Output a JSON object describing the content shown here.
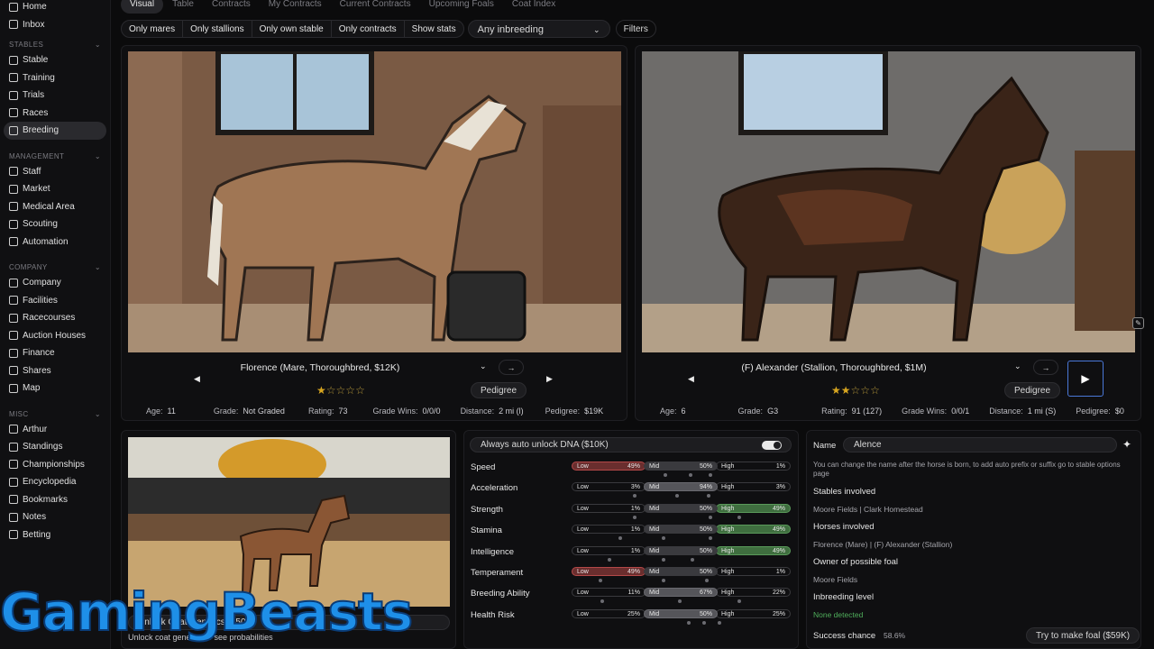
{
  "sidebar": {
    "top_items": [
      {
        "label": "Home",
        "icon": "home-icon"
      },
      {
        "label": "Inbox",
        "icon": "inbox-icon"
      }
    ],
    "groups": [
      {
        "title": "STABLES",
        "items": [
          {
            "label": "Stable",
            "icon": "stable-icon"
          },
          {
            "label": "Training",
            "icon": "training-icon"
          },
          {
            "label": "Trials",
            "icon": "trials-icon"
          },
          {
            "label": "Races",
            "icon": "races-icon"
          },
          {
            "label": "Breeding",
            "icon": "heart-icon",
            "active": true
          }
        ]
      },
      {
        "title": "MANAGEMENT",
        "items": [
          {
            "label": "Staff",
            "icon": "staff-icon"
          },
          {
            "label": "Market",
            "icon": "market-icon"
          },
          {
            "label": "Medical Area",
            "icon": "medical-icon"
          },
          {
            "label": "Scouting",
            "icon": "scouting-icon"
          },
          {
            "label": "Automation",
            "icon": "automation-icon"
          }
        ]
      },
      {
        "title": "COMPANY",
        "items": [
          {
            "label": "Company",
            "icon": "company-icon"
          },
          {
            "label": "Facilities",
            "icon": "facilities-icon"
          },
          {
            "label": "Racecourses",
            "icon": "racecourses-icon"
          },
          {
            "label": "Auction Houses",
            "icon": "auction-icon"
          },
          {
            "label": "Finance",
            "icon": "finance-icon"
          },
          {
            "label": "Shares",
            "icon": "shares-icon"
          },
          {
            "label": "Map",
            "icon": "map-icon"
          }
        ]
      },
      {
        "title": "MISC",
        "items": [
          {
            "label": "Arthur",
            "icon": "user-icon"
          },
          {
            "label": "Standings",
            "icon": "standings-icon"
          },
          {
            "label": "Championships",
            "icon": "championships-icon"
          },
          {
            "label": "Encyclopedia",
            "icon": "encyclopedia-icon"
          },
          {
            "label": "Bookmarks",
            "icon": "bookmark-icon"
          },
          {
            "label": "Notes",
            "icon": "notes-icon"
          },
          {
            "label": "Betting",
            "icon": "betting-icon"
          }
        ]
      }
    ]
  },
  "tabs": [
    "Visual",
    "Table",
    "Contracts",
    "My Contracts",
    "Current Contracts",
    "Upcoming Foals",
    "Coat Index"
  ],
  "filters": {
    "chips": [
      "Only mares",
      "Only stallions",
      "Only own stable",
      "Only contracts",
      "Show stats"
    ],
    "inbreeding_select": "Any inbreeding",
    "filters_button": "Filters"
  },
  "mare": {
    "title": "Florence (Mare, Thoroughbred, $12K)",
    "stars_filled": 1,
    "stars_total": 5,
    "pedigree_button": "Pedigree",
    "stats": [
      {
        "label": "Age:",
        "value": "11"
      },
      {
        "label": "Grade:",
        "value": "Not Graded"
      },
      {
        "label": "Rating:",
        "value": "73"
      },
      {
        "label": "Grade Wins:",
        "value": "0/0/0"
      },
      {
        "label": "Distance:",
        "value": "2 mi (l)"
      },
      {
        "label": "Pedigree:",
        "value": "$19K"
      }
    ]
  },
  "stallion": {
    "title": "(F) Alexander (Stallion, Thoroughbred, $1M)",
    "stars_filled": 2,
    "stars_total": 5,
    "pedigree_button": "Pedigree",
    "stats": [
      {
        "label": "Age:",
        "value": "6"
      },
      {
        "label": "Grade:",
        "value": "G3"
      },
      {
        "label": "Rating:",
        "value": "91 (127)"
      },
      {
        "label": "Grade Wins:",
        "value": "0/0/1"
      },
      {
        "label": "Distance:",
        "value": "1 mi (S)"
      },
      {
        "label": "Pedigree:",
        "value": "$0"
      }
    ]
  },
  "foal": {
    "unlock_button": "Unlock Coat Genetics ($50K)",
    "unlock_hint": "Unlock coat genetics to see probabilities"
  },
  "dna": {
    "toggle_label": "Always auto unlock DNA ($10K)",
    "toggle_on": true,
    "rows": [
      {
        "name": "Speed",
        "low": "49%",
        "mid": "50%",
        "high": "1%",
        "highlight": "low"
      },
      {
        "name": "Acceleration",
        "low": "3%",
        "mid": "94%",
        "high": "3%",
        "highlight": "mid"
      },
      {
        "name": "Strength",
        "low": "1%",
        "mid": "50%",
        "high": "49%",
        "highlight": "high"
      },
      {
        "name": "Stamina",
        "low": "1%",
        "mid": "50%",
        "high": "49%",
        "highlight": "high"
      },
      {
        "name": "Intelligence",
        "low": "1%",
        "mid": "50%",
        "high": "49%",
        "highlight": "high"
      },
      {
        "name": "Temperament",
        "low": "49%",
        "mid": "50%",
        "high": "1%",
        "highlight": "low"
      },
      {
        "name": "Breeding Ability",
        "low": "11%",
        "mid": "67%",
        "high": "22%",
        "highlight": "mid"
      },
      {
        "name": "Health Risk",
        "low": "25%",
        "mid": "50%",
        "high": "25%",
        "highlight": "mid"
      }
    ],
    "labels": {
      "low": "Low",
      "mid": "Mid",
      "high": "High"
    }
  },
  "info": {
    "name_label": "Name",
    "name_value": "Alence",
    "name_hint": "You can change the name after the horse is born, to add auto prefix or suffix go to stable options page",
    "stables_label": "Stables involved",
    "stables_value": "Moore Fields | Clark Homestead",
    "horses_label": "Horses involved",
    "horses_value": "Florence (Mare) | (F) Alexander (Stallion)",
    "owner_label": "Owner of possible foal",
    "owner_value": "Moore Fields",
    "inbreeding_label": "Inbreeding level",
    "inbreeding_value": "None detected",
    "success_label": "Success chance",
    "success_value": "58.6%",
    "make_foal_button": "Try to make foal ($59K)"
  },
  "watermark": "GamingBeasts",
  "colors": {
    "accent_blue": "#4a78d8",
    "low_red": "#b34848",
    "high_green": "#5a9a5a",
    "star_gold": "#d7a520",
    "none_detected_green": "#4fae5b"
  }
}
